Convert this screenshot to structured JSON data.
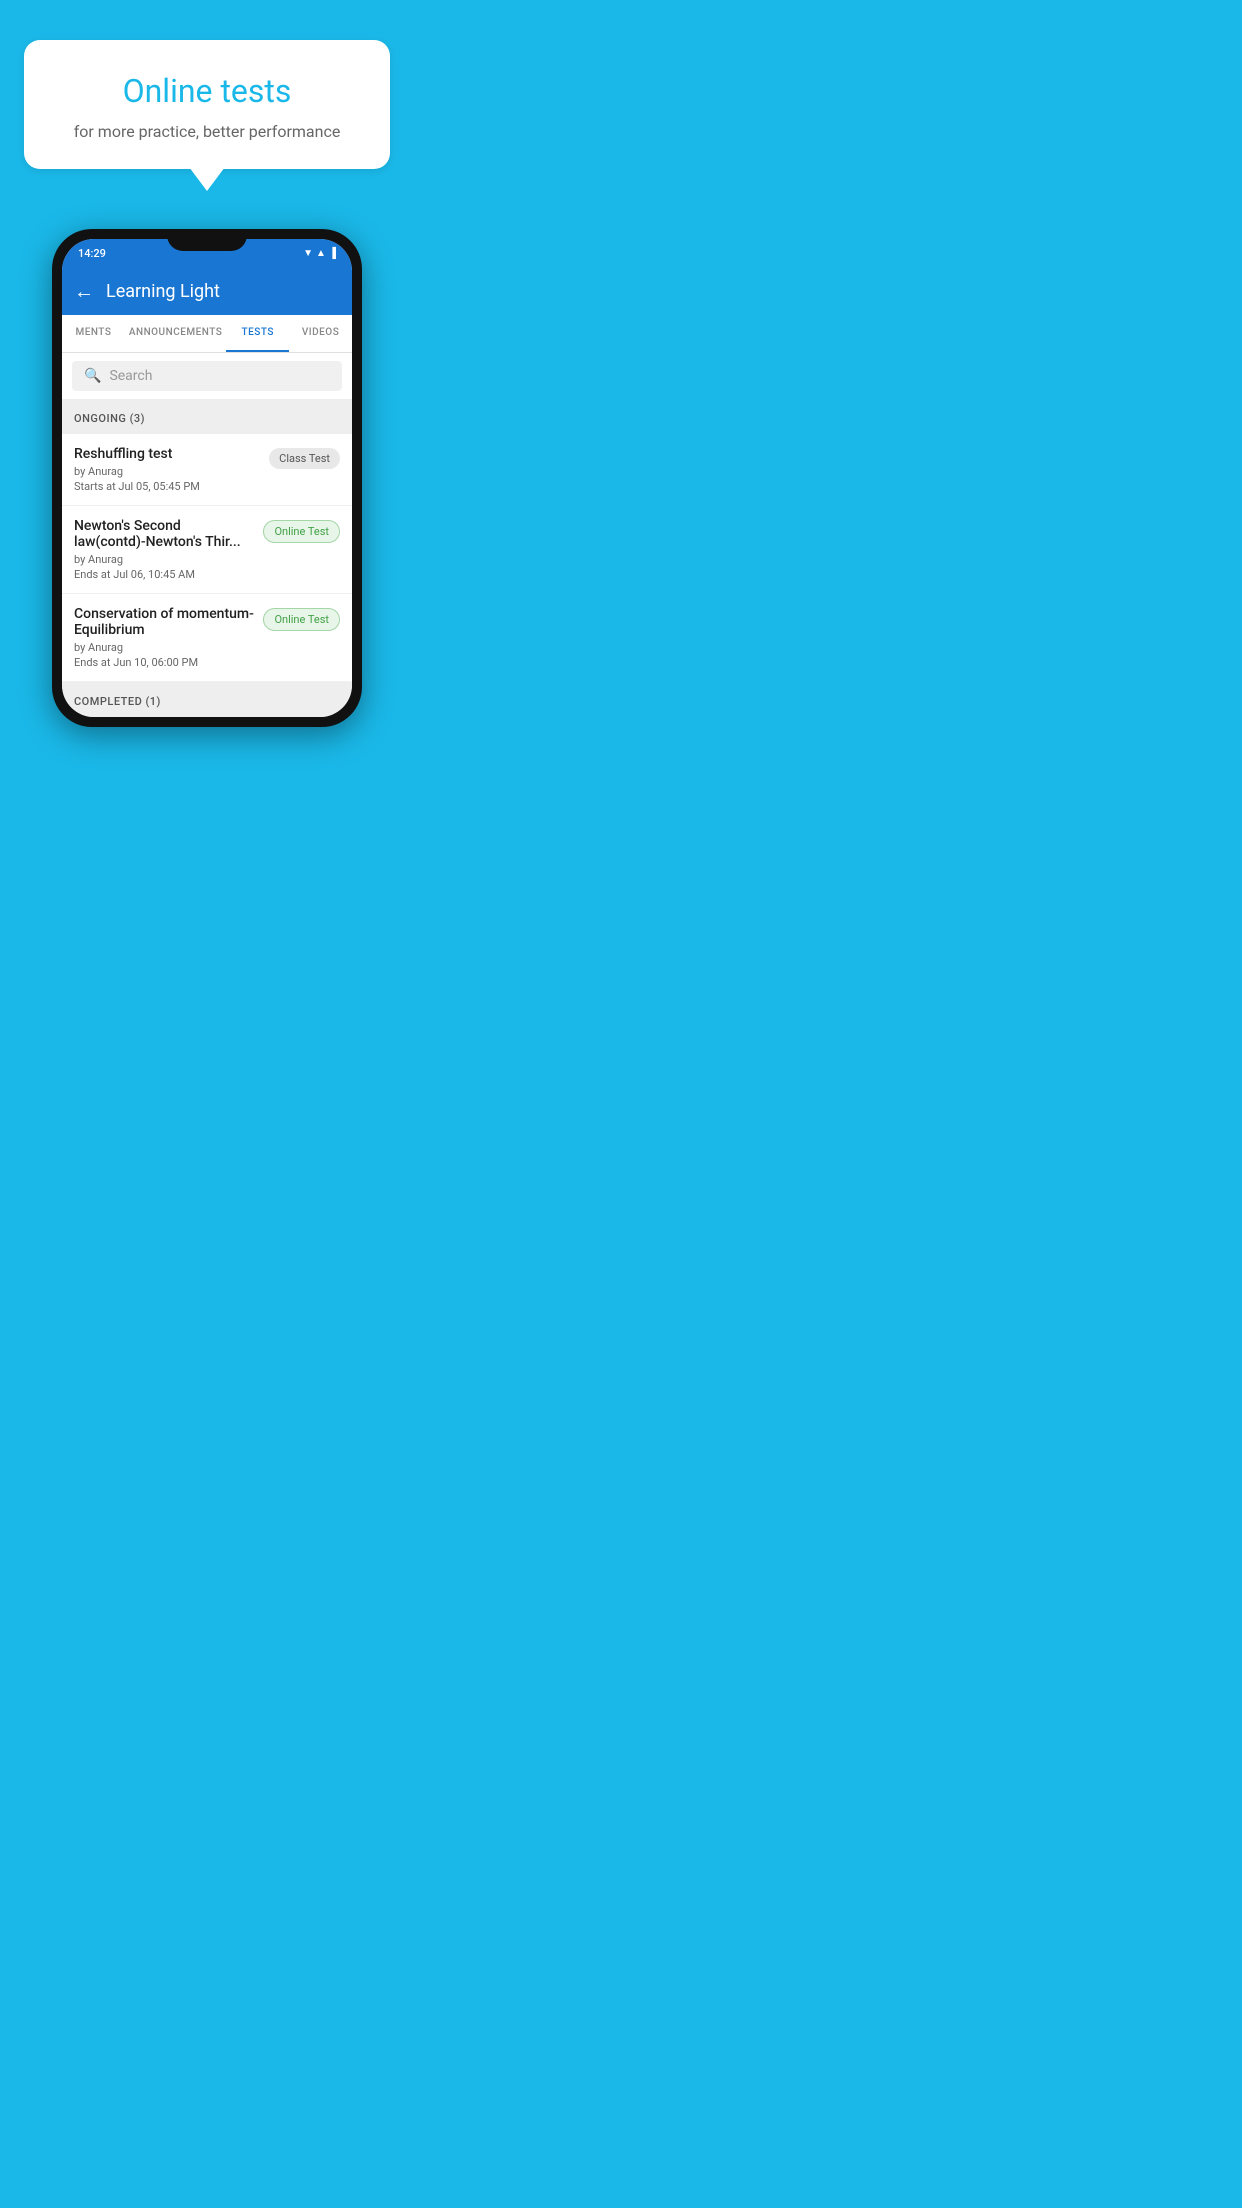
{
  "hero": {
    "title": "Online tests",
    "subtitle": "for more practice, better performance"
  },
  "phone": {
    "status_time": "14:29",
    "app_title": "Learning Light",
    "tabs": [
      {
        "label": "MENTS",
        "active": false
      },
      {
        "label": "ANNOUNCEMENTS",
        "active": false
      },
      {
        "label": "TESTS",
        "active": true
      },
      {
        "label": "VIDEOS",
        "active": false
      }
    ],
    "search_placeholder": "Search",
    "section_ongoing": "ONGOING (3)",
    "section_completed": "COMPLETED (1)",
    "tests": [
      {
        "name": "Reshuffling test",
        "author": "by Anurag",
        "date": "Starts at  Jul 05, 05:45 PM",
        "badge": "Class Test",
        "badge_type": "class"
      },
      {
        "name": "Newton's Second law(contd)-Newton's Thir...",
        "author": "by Anurag",
        "date": "Ends at  Jul 06, 10:45 AM",
        "badge": "Online Test",
        "badge_type": "online"
      },
      {
        "name": "Conservation of momentum-Equilibrium",
        "author": "by Anurag",
        "date": "Ends at  Jun 10, 06:00 PM",
        "badge": "Online Test",
        "badge_type": "online"
      }
    ]
  }
}
